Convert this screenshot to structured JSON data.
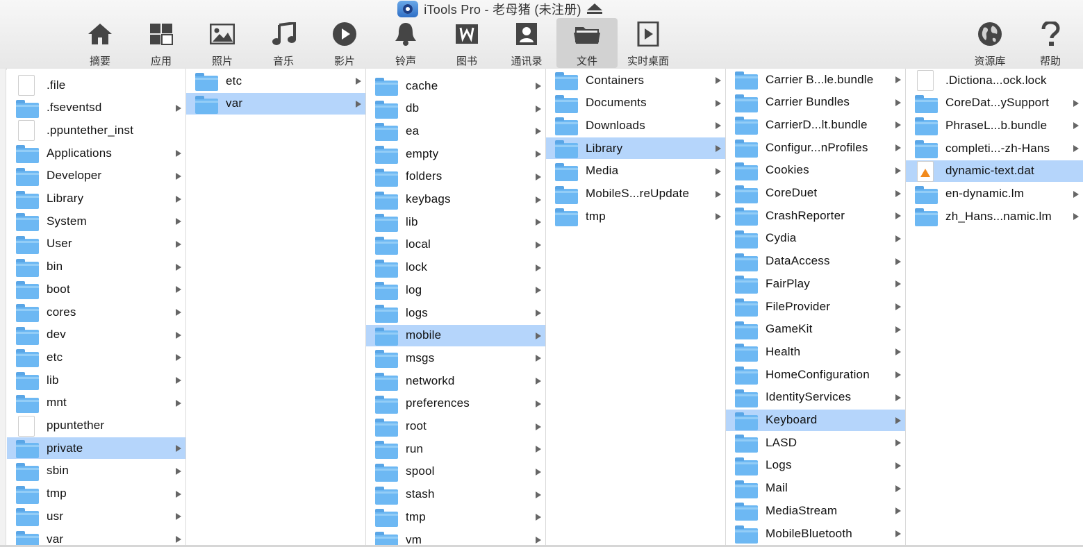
{
  "window": {
    "title": "iTools Pro - 老母猪 (未注册)"
  },
  "toolbar": {
    "items": [
      {
        "label": "摘要",
        "icon": "home-icon"
      },
      {
        "label": "应用",
        "icon": "apps-grid-icon"
      },
      {
        "label": "照片",
        "icon": "photo-icon"
      },
      {
        "label": "音乐",
        "icon": "music-note-icon"
      },
      {
        "label": "影片",
        "icon": "play-circle-icon"
      },
      {
        "label": "铃声",
        "icon": "bell-icon"
      },
      {
        "label": "图书",
        "icon": "book-icon"
      },
      {
        "label": "通讯录",
        "icon": "contacts-icon"
      },
      {
        "label": "文件",
        "icon": "folder-tray-icon",
        "active": true
      },
      {
        "label": "实时桌面",
        "icon": "screen-play-icon"
      }
    ],
    "right_items": [
      {
        "label": "资源库",
        "icon": "globe-icon"
      },
      {
        "label": "帮助",
        "icon": "help-icon"
      }
    ]
  },
  "columns": [
    {
      "items": [
        {
          "name": ".file",
          "type": "file"
        },
        {
          "name": ".fseventsd",
          "type": "folder"
        },
        {
          "name": ".ppuntether_inst",
          "type": "file"
        },
        {
          "name": "Applications",
          "type": "folder"
        },
        {
          "name": "Developer",
          "type": "folder"
        },
        {
          "name": "Library",
          "type": "folder"
        },
        {
          "name": "System",
          "type": "folder"
        },
        {
          "name": "User",
          "type": "folder"
        },
        {
          "name": "bin",
          "type": "folder"
        },
        {
          "name": "boot",
          "type": "folder"
        },
        {
          "name": "cores",
          "type": "folder"
        },
        {
          "name": "dev",
          "type": "folder"
        },
        {
          "name": "etc",
          "type": "folder"
        },
        {
          "name": "lib",
          "type": "folder"
        },
        {
          "name": "mnt",
          "type": "folder"
        },
        {
          "name": "ppuntether",
          "type": "file"
        },
        {
          "name": "private",
          "type": "folder",
          "selected": true
        },
        {
          "name": "sbin",
          "type": "folder"
        },
        {
          "name": "tmp",
          "type": "folder"
        },
        {
          "name": "usr",
          "type": "folder"
        },
        {
          "name": "var",
          "type": "folder"
        }
      ]
    },
    {
      "items": [
        {
          "name": "etc",
          "type": "folder"
        },
        {
          "name": "var",
          "type": "folder",
          "selected": true
        }
      ]
    },
    {
      "items": [
        {
          "name": "cache",
          "type": "folder"
        },
        {
          "name": "db",
          "type": "folder"
        },
        {
          "name": "ea",
          "type": "folder"
        },
        {
          "name": "empty",
          "type": "folder"
        },
        {
          "name": "folders",
          "type": "folder"
        },
        {
          "name": "keybags",
          "type": "folder"
        },
        {
          "name": "lib",
          "type": "folder"
        },
        {
          "name": "local",
          "type": "folder"
        },
        {
          "name": "lock",
          "type": "folder"
        },
        {
          "name": "log",
          "type": "folder"
        },
        {
          "name": "logs",
          "type": "folder"
        },
        {
          "name": "mobile",
          "type": "folder",
          "selected": true
        },
        {
          "name": "msgs",
          "type": "folder"
        },
        {
          "name": "networkd",
          "type": "folder"
        },
        {
          "name": "preferences",
          "type": "folder"
        },
        {
          "name": "root",
          "type": "folder"
        },
        {
          "name": "run",
          "type": "folder"
        },
        {
          "name": "spool",
          "type": "folder"
        },
        {
          "name": "stash",
          "type": "folder"
        },
        {
          "name": "tmp",
          "type": "folder"
        },
        {
          "name": "vm",
          "type": "folder"
        }
      ]
    },
    {
      "items": [
        {
          "name": "Containers",
          "type": "folder"
        },
        {
          "name": "Documents",
          "type": "folder"
        },
        {
          "name": "Downloads",
          "type": "folder"
        },
        {
          "name": "Library",
          "type": "folder",
          "selected": true
        },
        {
          "name": "Media",
          "type": "folder"
        },
        {
          "name": "MobileS...reUpdate",
          "type": "folder"
        },
        {
          "name": "tmp",
          "type": "folder"
        }
      ]
    },
    {
      "items": [
        {
          "name": "Carrier B...le.bundle",
          "type": "folder"
        },
        {
          "name": "Carrier Bundles",
          "type": "folder"
        },
        {
          "name": "CarrierD...lt.bundle",
          "type": "folder"
        },
        {
          "name": "Configur...nProfiles",
          "type": "folder"
        },
        {
          "name": "Cookies",
          "type": "folder"
        },
        {
          "name": "CoreDuet",
          "type": "folder"
        },
        {
          "name": "CrashReporter",
          "type": "folder"
        },
        {
          "name": "Cydia",
          "type": "folder"
        },
        {
          "name": "DataAccess",
          "type": "folder"
        },
        {
          "name": "FairPlay",
          "type": "folder"
        },
        {
          "name": "FileProvider",
          "type": "folder"
        },
        {
          "name": "GameKit",
          "type": "folder"
        },
        {
          "name": "Health",
          "type": "folder"
        },
        {
          "name": "HomeConfiguration",
          "type": "folder"
        },
        {
          "name": "IdentityServices",
          "type": "folder"
        },
        {
          "name": "Keyboard",
          "type": "folder",
          "selected": true
        },
        {
          "name": "LASD",
          "type": "folder"
        },
        {
          "name": "Logs",
          "type": "folder"
        },
        {
          "name": "Mail",
          "type": "folder"
        },
        {
          "name": "MediaStream",
          "type": "folder"
        },
        {
          "name": "MobileBluetooth",
          "type": "folder"
        }
      ]
    },
    {
      "items": [
        {
          "name": ".Dictiona...ock.lock",
          "type": "file"
        },
        {
          "name": "CoreDat...ySupport",
          "type": "folder"
        },
        {
          "name": "PhraseL...b.bundle",
          "type": "folder"
        },
        {
          "name": "completi...-zh-Hans",
          "type": "folder"
        },
        {
          "name": "dynamic-text.dat",
          "type": "vlc-file",
          "selected": true
        },
        {
          "name": "en-dynamic.lm",
          "type": "folder"
        },
        {
          "name": "zh_Hans...namic.lm",
          "type": "folder"
        }
      ]
    }
  ]
}
